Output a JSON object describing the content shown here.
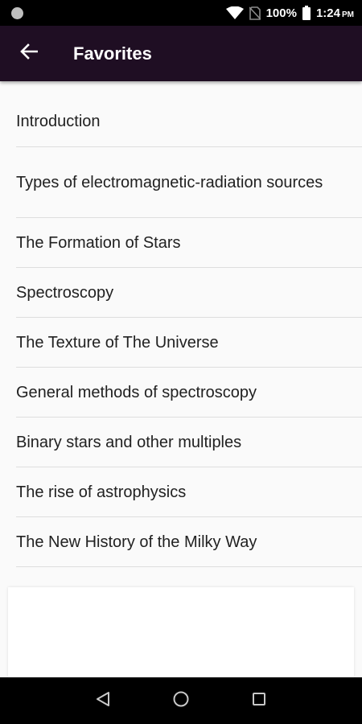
{
  "status_bar": {
    "battery": "100%",
    "time": "1:24",
    "ampm": "PM"
  },
  "app_bar": {
    "title": "Favorites"
  },
  "favorites": [
    "Introduction",
    "Types of electromagnetic-radiation sources",
    "The Formation of Stars",
    "Spectroscopy",
    "The Texture of The Universe",
    "General methods of spectroscopy",
    "Binary stars and other multiples",
    "The rise of astrophysics",
    "The New History of the Milky Way"
  ],
  "colors": {
    "app_bar": "#1f0e23",
    "background": "#fafafa",
    "text": "#212121"
  }
}
